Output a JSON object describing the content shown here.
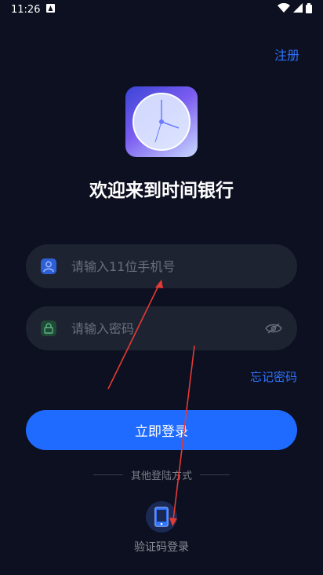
{
  "status_bar": {
    "time": "11:26"
  },
  "header": {
    "register_label": "注册"
  },
  "welcome_title": "欢迎来到时间银行",
  "phone_field": {
    "placeholder": "请输入11位手机号"
  },
  "password_field": {
    "placeholder": "请输入密码"
  },
  "forgot_password_label": "忘记密码",
  "login_button_label": "立即登录",
  "other_methods_label": "其他登陆方式",
  "sms_login_label": "验证码登录",
  "colors": {
    "accent": "#1f6bff",
    "link": "#2f73ff",
    "background": "#0c1020",
    "field": "#1e2332"
  }
}
